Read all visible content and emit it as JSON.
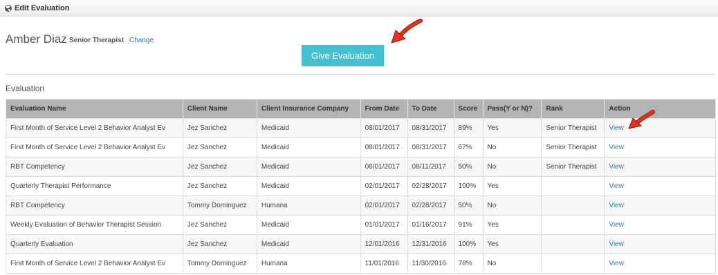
{
  "window": {
    "title": "Edit Evaluation",
    "icon": "globe-icon"
  },
  "header": {
    "name": "Amber Diaz",
    "role": "Senior Therapist",
    "change_label": "Change",
    "give_button_label": "Give Evaluation"
  },
  "section": {
    "title": "Evaluation"
  },
  "table": {
    "columns": [
      "Evaluation Name",
      "Client Name",
      "Client Insurance Company",
      "From Date",
      "To Date",
      "Score",
      "Pass(Y or N)?",
      "Rank",
      "Action"
    ],
    "rows": [
      {
        "name": "First Month of Service Level 2 Behavior Analyst Ev",
        "client": "Jez Sanchez",
        "insurance": "Medicaid",
        "from": "08/01/2017",
        "to": "08/31/2017",
        "score": "89%",
        "pass": "Yes",
        "rank": "Senior Therapist",
        "action": "View"
      },
      {
        "name": "First Month of Service Level 2 Behavior Analyst Ev",
        "client": "Jez Sanchez",
        "insurance": "Medicaid",
        "from": "08/01/2017",
        "to": "08/31/2017",
        "score": "67%",
        "pass": "No",
        "rank": "Senior Therapist",
        "action": "View"
      },
      {
        "name": "RBT Competency",
        "client": "Jez Sanchez",
        "insurance": "Medicaid",
        "from": "08/01/2017",
        "to": "08/11/2017",
        "score": "50%",
        "pass": "No",
        "rank": "Senior Therapist",
        "action": "View"
      },
      {
        "name": "Quarterly Therapist Performance",
        "client": "Jez Sanchez",
        "insurance": "Medicaid",
        "from": "02/01/2017",
        "to": "02/28/2017",
        "score": "100%",
        "pass": "Yes",
        "rank": "",
        "action": "View"
      },
      {
        "name": "RBT Competency",
        "client": "Tommy Dominguez",
        "insurance": "Humana",
        "from": "02/01/2017",
        "to": "02/28/2017",
        "score": "50%",
        "pass": "No",
        "rank": "",
        "action": "View"
      },
      {
        "name": "Weekly Evaluation of Behavior Therapist Session",
        "client": "Jez Sanchez",
        "insurance": "Medicaid",
        "from": "01/01/2017",
        "to": "01/16/2017",
        "score": "91%",
        "pass": "Yes",
        "rank": "",
        "action": "View"
      },
      {
        "name": "Quarterly Evaluation",
        "client": "Jez Sanchez",
        "insurance": "Medicaid",
        "from": "12/01/2016",
        "to": "12/31/2016",
        "score": "100%",
        "pass": "Yes",
        "rank": "",
        "action": "View"
      },
      {
        "name": "First Month of Service Level 2 Behavior Analyst Ev",
        "client": "Tommy Dominguez",
        "insurance": "Humana",
        "from": "11/01/2016",
        "to": "11/30/2016",
        "score": "78%",
        "pass": "No",
        "rank": "",
        "action": "View"
      }
    ]
  },
  "colors": {
    "button": "#46c0d1",
    "link": "#2a7ab0",
    "header_bg": "#b3b3b3",
    "annotation_arrow": "#e8321c"
  }
}
